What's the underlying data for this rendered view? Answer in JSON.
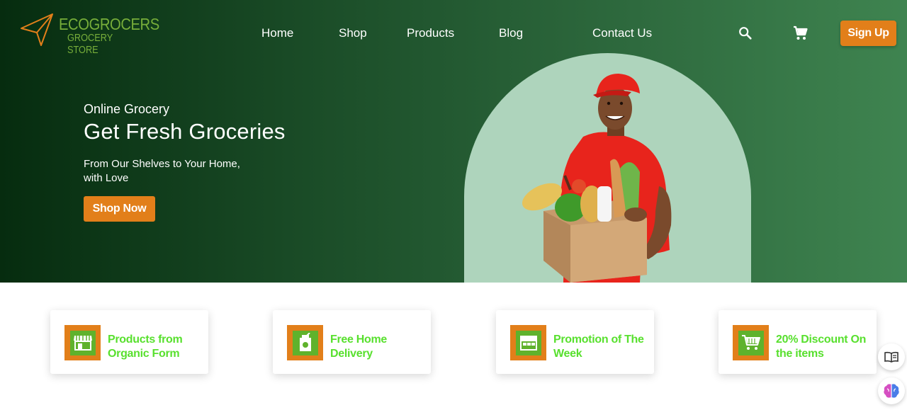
{
  "brand": {
    "name": "ECOGROCERS",
    "tagline": "GROCERY STORE",
    "color": "#77ae3a"
  },
  "nav": {
    "items": [
      {
        "label": "Home"
      },
      {
        "label": "Shop"
      },
      {
        "label": "Products"
      },
      {
        "label": "Blog"
      },
      {
        "label": "Contact Us"
      }
    ],
    "search_icon": "search-icon",
    "cart_icon": "cart-icon",
    "signup_label": "Sign Up"
  },
  "hero": {
    "eyebrow": "Online Grocery",
    "title": "Get Fresh Groceries",
    "description": "From Our Shelves to Your Home, with Love",
    "cta_label": "Shop Now",
    "image": "delivery-man-with-grocery-box"
  },
  "features": [
    {
      "label": "Products from Organic Form",
      "icon": "storefront-icon"
    },
    {
      "label": "Free Home Delivery",
      "icon": "delivery-bag-icon"
    },
    {
      "label": "Promotion of The Week",
      "icon": "shop-icon"
    },
    {
      "label": "20% Discount On the items",
      "icon": "cart-icon"
    }
  ],
  "colors": {
    "accent": "#e27f1a",
    "feature_text": "#58e02e",
    "hero_start": "#062c0f",
    "hero_end": "#3f8450",
    "arch": "#aed4bc"
  }
}
